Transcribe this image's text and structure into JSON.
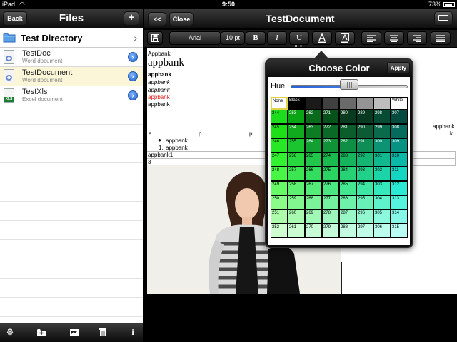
{
  "status_bar": {
    "device": "iPad",
    "time": "9:50",
    "battery": "73%"
  },
  "left_pane": {
    "back_label": "Back",
    "title": "Files",
    "add_label": "+",
    "directory": "Test Directory",
    "files": [
      {
        "name": "TestDoc",
        "type": "Word document",
        "icon": "word-icon"
      },
      {
        "name": "TestDocument",
        "type": "Word document",
        "icon": "word-icon",
        "selected": true
      },
      {
        "name": "TestXls",
        "type": "Excel document",
        "icon": "excel-icon",
        "badge": "XLS"
      }
    ],
    "toolbar_icons": [
      "gear-icon",
      "new-folder-icon",
      "import-photo-icon",
      "trash-icon",
      "info-icon"
    ]
  },
  "right_pane": {
    "collapse_label": "<<",
    "close_label": "Close",
    "title": "TestDocument",
    "format_bar": {
      "font": "Arial",
      "size": "10 pt",
      "bold": "B",
      "italic": "I",
      "underline": "U",
      "icons": [
        "save-icon",
        "text-color-icon",
        "highlight-color-icon",
        "align-left-icon",
        "align-center-icon",
        "align-right-icon",
        "justify-icon"
      ]
    },
    "document": {
      "line1": "Appbank",
      "heading": "appbank",
      "bold": "appbank",
      "italic": "appbank",
      "underline": "appbank",
      "red": "appbank",
      "plain": "appbank",
      "right_text": "appbank",
      "right_k": "k",
      "row_letters": [
        "a",
        "p",
        "p"
      ],
      "bullet_item": "appbank",
      "numbered_marker": "1.",
      "numbered_item": "appbank",
      "table_cell1": "appbank1",
      "table_cell2": "3"
    }
  },
  "color_picker": {
    "title": "Choose Color",
    "apply_label": "Apply",
    "hue_label": "Hue",
    "hue_value": 0.5,
    "first_row": [
      {
        "label": "None",
        "color": "#ffffff"
      },
      {
        "label": "Black",
        "color": "#000000"
      },
      {
        "label": "",
        "color": "#1a1a1a"
      },
      {
        "label": "",
        "color": "#404040"
      },
      {
        "label": "",
        "color": "#6a6a6a"
      },
      {
        "label": "",
        "color": "#949494"
      },
      {
        "label": "",
        "color": "#bdbdbd"
      },
      {
        "label": "White",
        "color": "#ffffff"
      }
    ],
    "rows": [
      {
        "labels": [
          "244",
          "253",
          "262",
          "271",
          "280",
          "289",
          "298",
          "307"
        ],
        "colors": [
          "#1ddc1d",
          "#09a514",
          "#086a1a",
          "#07511b",
          "#0b3b1e",
          "#083a21",
          "#064b33",
          "#034b3f"
        ]
      },
      {
        "labels": [
          "245",
          "254",
          "263",
          "272",
          "281",
          "290",
          "299",
          "308"
        ],
        "colors": [
          "#1de018",
          "#11a91d",
          "#0d7d24",
          "#0b6928",
          "#0b5d2c",
          "#0c5b35",
          "#0a6a4c",
          "#066a5d"
        ]
      },
      {
        "labels": [
          "246",
          "255",
          "264",
          "273",
          "282",
          "291",
          "300",
          "309"
        ],
        "colors": [
          "#27e824",
          "#1ac52f",
          "#12a032",
          "#109238",
          "#0f8f45",
          "#0e8d56",
          "#0c9373",
          "#079384"
        ]
      },
      {
        "labels": [
          "247",
          "256",
          "265",
          "274",
          "283",
          "292",
          "301",
          "310"
        ],
        "colors": [
          "#33f030",
          "#28d83f",
          "#21c64a",
          "#1bba4e",
          "#17b45e",
          "#14b472",
          "#11b88f",
          "#0ab8a8"
        ]
      },
      {
        "labels": [
          "248",
          "257",
          "266",
          "275",
          "284",
          "293",
          "302",
          "311"
        ],
        "colors": [
          "#49f545",
          "#3ce653",
          "#33dd5e",
          "#2bd462",
          "#27d275",
          "#22d189",
          "#1bd5a8",
          "#14d5c2"
        ]
      },
      {
        "labels": [
          "249",
          "258",
          "267",
          "276",
          "285",
          "294",
          "303",
          "312"
        ],
        "colors": [
          "#68f966",
          "#5ef070",
          "#55ec7a",
          "#4ce783",
          "#45e691",
          "#3de7a3",
          "#35e9bd",
          "#2be9d4"
        ]
      },
      {
        "labels": [
          "250",
          "259",
          "268",
          "277",
          "286",
          "295",
          "304",
          "313"
        ],
        "colors": [
          "#8bfb89",
          "#82f68f",
          "#7bf398",
          "#74f1a0",
          "#6ef1ab",
          "#67f1b8",
          "#5ff3cc",
          "#55f3dd"
        ]
      },
      {
        "labels": [
          "251",
          "260",
          "269",
          "278",
          "287",
          "296",
          "305",
          "314"
        ],
        "colors": [
          "#adfdab",
          "#a7fab0",
          "#a1f9b6",
          "#9cf7bc",
          "#98f7c4",
          "#92f7ce",
          "#8cf8dd",
          "#85f8e8"
        ]
      },
      {
        "labels": [
          "252",
          "261",
          "270",
          "279",
          "288",
          "297",
          "306",
          "315"
        ],
        "colors": [
          "#cffed0",
          "#cbfdd3",
          "#c8fcd7",
          "#c5fbdb",
          "#c2fbe1",
          "#bffbe7",
          "#bcfcef",
          "#b9fcf4"
        ]
      }
    ]
  }
}
